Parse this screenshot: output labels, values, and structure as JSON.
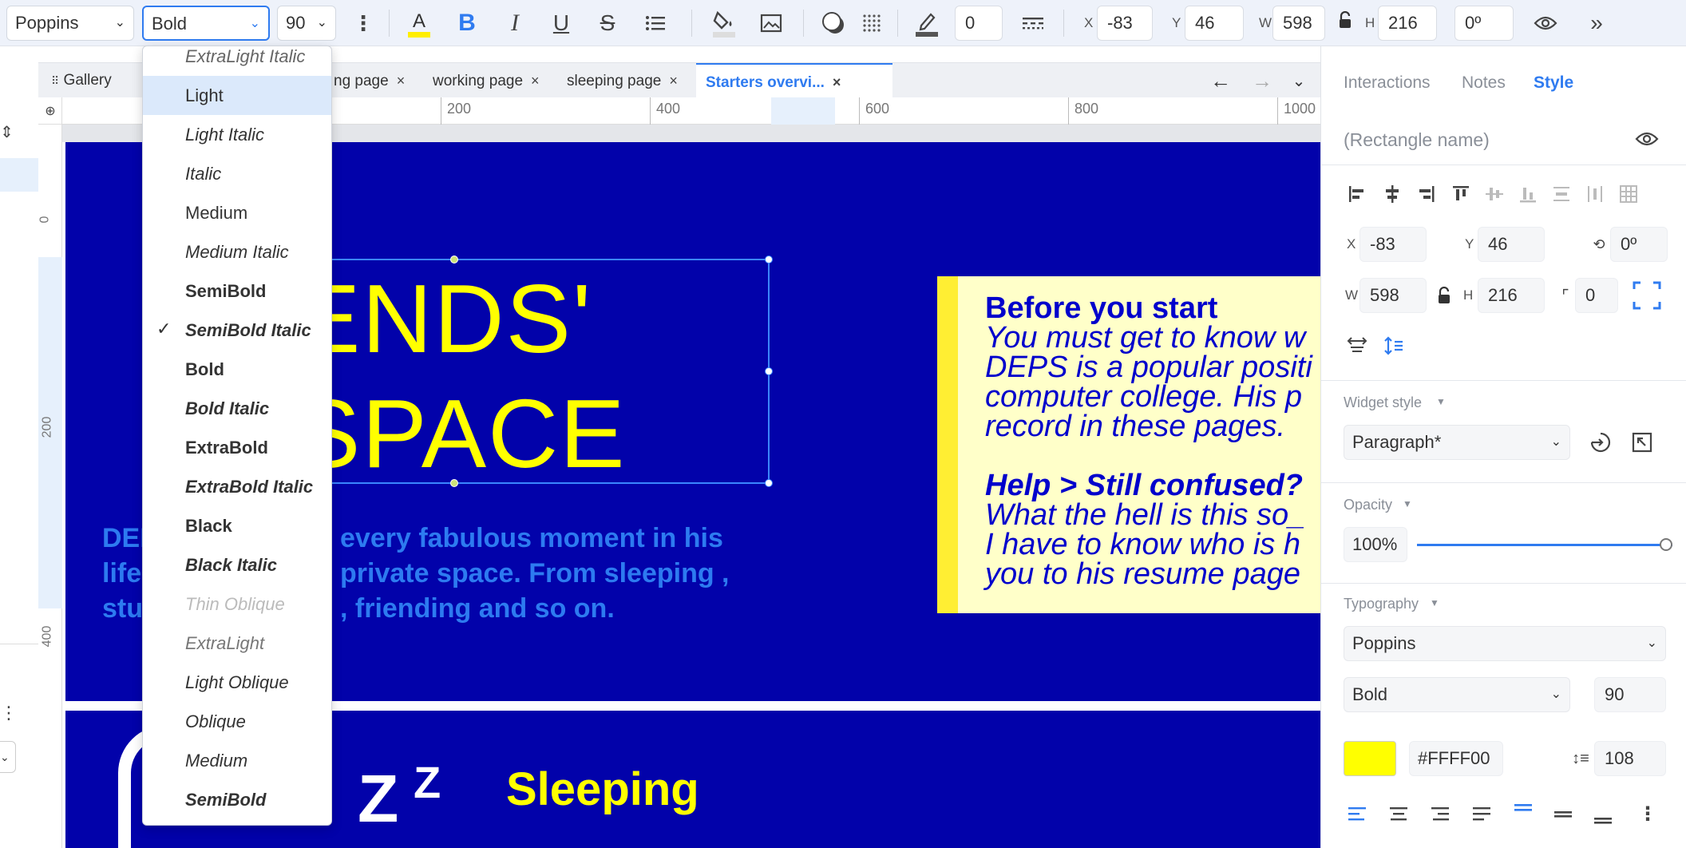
{
  "toolbar": {
    "font_family": "Poppins",
    "font_weight": "Bold",
    "font_size": "90",
    "stroke_value": "0",
    "x_label": "X",
    "x_value": "-83",
    "y_label": "Y",
    "y_value": "46",
    "w_label": "W",
    "w_value": "598",
    "h_label": "H",
    "h_value": "216",
    "rotation": "0º"
  },
  "tabs": [
    {
      "label": "Gallery"
    },
    {
      "label": "ng page"
    },
    {
      "label": "working page"
    },
    {
      "label": "sleeping page"
    },
    {
      "label": "Starters overvi..."
    }
  ],
  "ruler": [
    "200",
    "400",
    "600",
    "800",
    "1000"
  ],
  "vruler": [
    "0",
    "200",
    "400"
  ],
  "canvas": {
    "headline_line1": "ENDS'",
    "headline_line2": "SPACE",
    "body_line1_a": "DEF",
    "body_line1_b": "every fabulous moment in his",
    "body_line2_a": "life",
    "body_line2_b": "private space. From sleeping ,",
    "body_line3_a": "stu",
    "body_line3_b": ", friending and so on.",
    "note_title": "Before you start",
    "note_l1": "You must get to know w",
    "note_l2": "DEPS is a popular positi",
    "note_l3": "computer college. His p",
    "note_l4": "record in these pages.",
    "note_help": "Help > Still confused?",
    "note_l5": "What the hell is this so_",
    "note_l6": "I have to know who is h",
    "note_l7": "you to his resume page",
    "zzz_big": "Z",
    "zzz_small": "Z",
    "section_title": "Sleeping"
  },
  "dropdown": {
    "items": [
      {
        "label": "ExtraLight Italic"
      },
      {
        "label": "Light"
      },
      {
        "label": "Light Italic"
      },
      {
        "label": "Italic"
      },
      {
        "label": "Medium"
      },
      {
        "label": "Medium Italic"
      },
      {
        "label": "SemiBold"
      },
      {
        "label": "SemiBold Italic"
      },
      {
        "label": "Bold"
      },
      {
        "label": "Bold Italic"
      },
      {
        "label": "ExtraBold"
      },
      {
        "label": "ExtraBold Italic"
      },
      {
        "label": "Black"
      },
      {
        "label": "Black Italic"
      },
      {
        "label": "Thin Oblique"
      },
      {
        "label": "ExtraLight"
      },
      {
        "label": "Light Oblique"
      },
      {
        "label": "Oblique"
      },
      {
        "label": "Medium"
      },
      {
        "label": "SemiBold"
      }
    ],
    "selected": "Bold",
    "highlighted": "Light"
  },
  "panel": {
    "tab_interactions": "Interactions",
    "tab_notes": "Notes",
    "tab_style": "Style",
    "name_placeholder": "(Rectangle name)",
    "x_label": "X",
    "x_value": "-83",
    "y_label": "Y",
    "y_value": "46",
    "rot_value": "0º",
    "w_label": "W",
    "w_value": "598",
    "h_label": "H",
    "h_value": "216",
    "radius_value": "0",
    "widget_style_header": "Widget style",
    "widget_style_value": "Paragraph*",
    "opacity_header": "Opacity",
    "opacity_value": "100%",
    "opacity_level": 1.0,
    "typography_header": "Typography",
    "font_family": "Poppins",
    "font_weight": "Bold",
    "font_size": "90",
    "color_hex": "#FFFF00",
    "line_height": "108"
  },
  "colors": {
    "accent": "#2f7bf0",
    "canvas_bg": "#0202aa",
    "headline": "#ffff00",
    "note_bg": "#ffffc9",
    "note_bar": "#ffee33",
    "swatch": "#FFFF00"
  }
}
